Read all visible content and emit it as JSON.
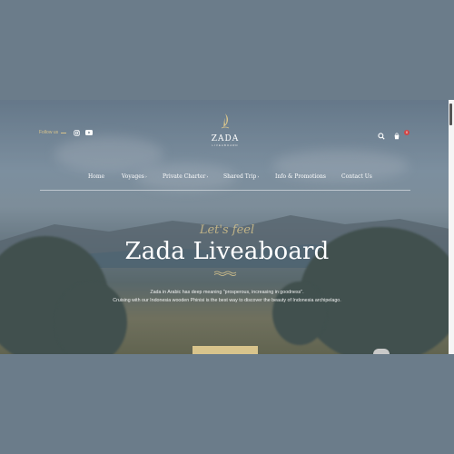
{
  "header": {
    "follow_label": "Follow us",
    "social_icons": [
      "instagram-icon",
      "youtube-icon"
    ],
    "logo_name": "ZADA",
    "logo_sub": "LIVEABOARD",
    "cart_count": "0",
    "right_icons": [
      "search-icon",
      "cart-icon"
    ]
  },
  "nav": {
    "items": [
      {
        "label": "Home",
        "caret": ""
      },
      {
        "label": "Voyages",
        "caret": "›"
      },
      {
        "label": "Private Charter",
        "caret": "›"
      },
      {
        "label": "Shared Trip",
        "caret": "›"
      },
      {
        "label": "Info & Promotions",
        "caret": ""
      },
      {
        "label": "Contact Us",
        "caret": ""
      }
    ]
  },
  "hero": {
    "tagline": "Let's feel",
    "title": "Zada Liveaboard",
    "desc_line1": "Zada in Arabic has deep meaning \"prosperous, increasing in goodness\".",
    "desc_line2": "Cruising with our Indonesia wooden Phinisi is the best way to discover the beauty of Indonesia archipelago.",
    "cta_label": ""
  },
  "colors": {
    "accent": "#d8c48c",
    "page_bg": "#6b7c8a",
    "badge": "#d04646"
  }
}
